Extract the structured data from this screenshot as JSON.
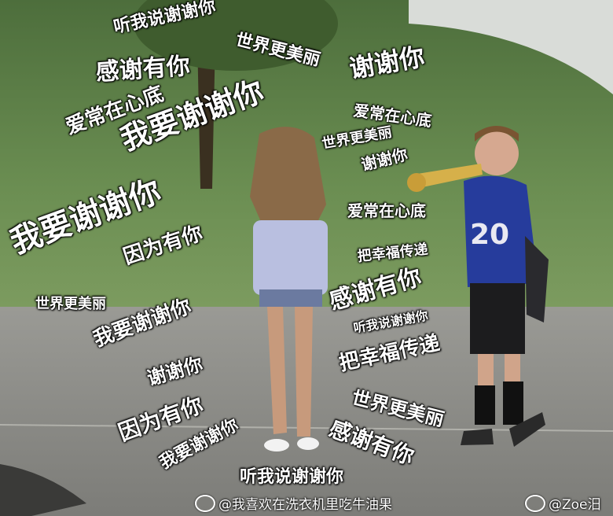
{
  "captions": [
    {
      "text": "听我说谢谢你",
      "size": 22,
      "rot": -12
    },
    {
      "text": "世界更美丽",
      "size": 22,
      "rot": 14
    },
    {
      "text": "感谢有你",
      "size": 30,
      "rot": -4
    },
    {
      "text": "谢谢你",
      "size": 32,
      "rot": -10
    },
    {
      "text": "爱常在心底",
      "size": 26,
      "rot": -20
    },
    {
      "text": "我要谢谢你",
      "size": 38,
      "rot": -20
    },
    {
      "text": "爱常在心底",
      "size": 20,
      "rot": 8
    },
    {
      "text": "世界更美丽",
      "size": 18,
      "rot": -10
    },
    {
      "text": "谢谢你",
      "size": 20,
      "rot": -14
    },
    {
      "text": "我要谢谢你",
      "size": 40,
      "rot": -20
    },
    {
      "text": "爱常在心底",
      "size": 20,
      "rot": 0
    },
    {
      "text": "因为有你",
      "size": 26,
      "rot": -18
    },
    {
      "text": "把幸福传递",
      "size": 18,
      "rot": -6
    },
    {
      "text": "世界更美丽",
      "size": 18,
      "rot": 0
    },
    {
      "text": "感谢有你",
      "size": 30,
      "rot": -16
    },
    {
      "text": "我要谢谢你",
      "size": 26,
      "rot": -20
    },
    {
      "text": "听我说谢谢你",
      "size": 16,
      "rot": -10
    },
    {
      "text": "把幸福传递",
      "size": 26,
      "rot": -12
    },
    {
      "text": "谢谢你",
      "size": 24,
      "rot": -16
    },
    {
      "text": "世界更美丽",
      "size": 24,
      "rot": 14
    },
    {
      "text": "因为有你",
      "size": 28,
      "rot": -20
    },
    {
      "text": "感谢有你",
      "size": 28,
      "rot": 20
    },
    {
      "text": "我要谢谢你",
      "size": 22,
      "rot": -28
    },
    {
      "text": "听我说谢谢你",
      "size": 22,
      "rot": 0
    }
  ],
  "watermarks": {
    "left": "@我喜欢在洗衣机里吃牛油果",
    "right": "@Zoe汨"
  },
  "colors": {
    "grass": "#5b7c48",
    "road": "#8a8a86",
    "caption": "#ffffff"
  }
}
